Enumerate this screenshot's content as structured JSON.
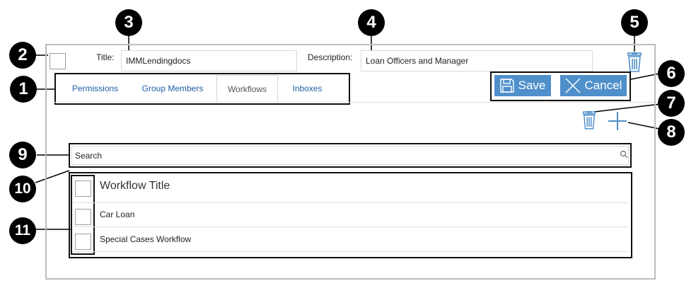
{
  "form": {
    "title_label": "Title:",
    "title_value": "IMMLendingdocs",
    "description_label": "Description:",
    "description_value": "Loan Officers and Manager"
  },
  "tabs": [
    {
      "label": "Permissions"
    },
    {
      "label": "Group Members"
    },
    {
      "label": "Workflows",
      "active": true
    },
    {
      "label": "Inboxes"
    }
  ],
  "actions": {
    "save_label": "Save",
    "cancel_label": "Cancel"
  },
  "search": {
    "placeholder": "Search"
  },
  "list": {
    "header": "Workflow Title",
    "rows": [
      {
        "title": "Car Loan"
      },
      {
        "title": "Special Cases Workflow"
      }
    ]
  },
  "callouts": [
    "1",
    "2",
    "3",
    "4",
    "5",
    "6",
    "7",
    "8",
    "9",
    "10",
    "11"
  ],
  "colors": {
    "accent": "#4f8fca",
    "link": "#1f5fa8",
    "badge": "#000000"
  }
}
